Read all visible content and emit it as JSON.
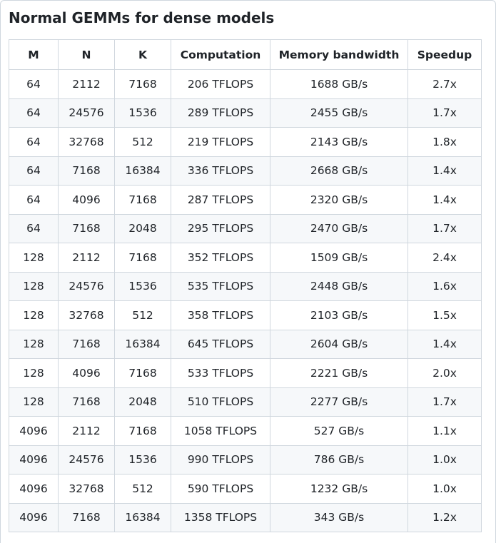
{
  "title": "Normal GEMMs for dense models",
  "table": {
    "headers": [
      "M",
      "N",
      "K",
      "Computation",
      "Memory bandwidth",
      "Speedup"
    ],
    "rows": [
      [
        "64",
        "2112",
        "7168",
        "206 TFLOPS",
        "1688 GB/s",
        "2.7x"
      ],
      [
        "64",
        "24576",
        "1536",
        "289 TFLOPS",
        "2455 GB/s",
        "1.7x"
      ],
      [
        "64",
        "32768",
        "512",
        "219 TFLOPS",
        "2143 GB/s",
        "1.8x"
      ],
      [
        "64",
        "7168",
        "16384",
        "336 TFLOPS",
        "2668 GB/s",
        "1.4x"
      ],
      [
        "64",
        "4096",
        "7168",
        "287 TFLOPS",
        "2320 GB/s",
        "1.4x"
      ],
      [
        "64",
        "7168",
        "2048",
        "295 TFLOPS",
        "2470 GB/s",
        "1.7x"
      ],
      [
        "128",
        "2112",
        "7168",
        "352 TFLOPS",
        "1509 GB/s",
        "2.4x"
      ],
      [
        "128",
        "24576",
        "1536",
        "535 TFLOPS",
        "2448 GB/s",
        "1.6x"
      ],
      [
        "128",
        "32768",
        "512",
        "358 TFLOPS",
        "2103 GB/s",
        "1.5x"
      ],
      [
        "128",
        "7168",
        "16384",
        "645 TFLOPS",
        "2604 GB/s",
        "1.4x"
      ],
      [
        "128",
        "4096",
        "7168",
        "533 TFLOPS",
        "2221 GB/s",
        "2.0x"
      ],
      [
        "128",
        "7168",
        "2048",
        "510 TFLOPS",
        "2277 GB/s",
        "1.7x"
      ],
      [
        "4096",
        "2112",
        "7168",
        "1058 TFLOPS",
        "527 GB/s",
        "1.1x"
      ],
      [
        "4096",
        "24576",
        "1536",
        "990 TFLOPS",
        "786 GB/s",
        "1.0x"
      ],
      [
        "4096",
        "32768",
        "512",
        "590 TFLOPS",
        "1232 GB/s",
        "1.0x"
      ],
      [
        "4096",
        "7168",
        "16384",
        "1358 TFLOPS",
        "343 GB/s",
        "1.2x"
      ]
    ]
  }
}
